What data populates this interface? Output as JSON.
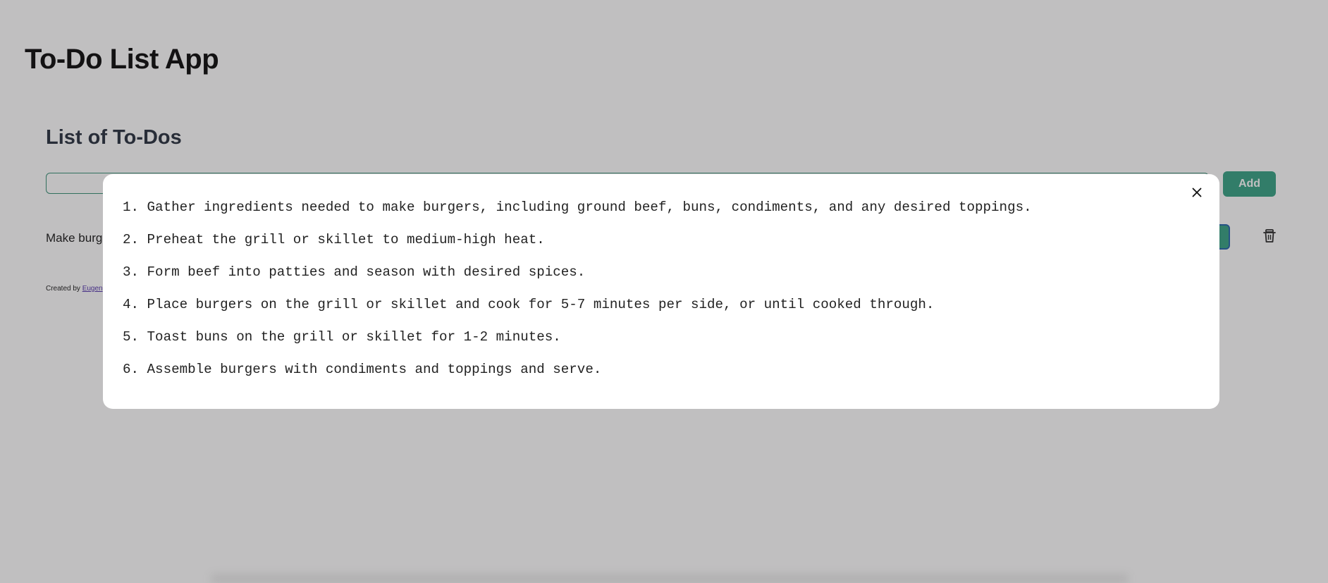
{
  "app": {
    "title": "To-Do List App"
  },
  "card": {
    "title": "List of To-Dos",
    "add_label": "Add",
    "input_value": "",
    "input_placeholder": ""
  },
  "todos": [
    {
      "text": "Make burgers",
      "visible_text": "Make burge"
    }
  ],
  "footer": {
    "prefix": "Created by ",
    "author_link_visible": "Eugen"
  },
  "modal": {
    "steps": [
      "1. Gather ingredients needed to make burgers, including ground beef, buns, condiments, and any desired toppings.",
      "2. Preheat the grill or skillet to medium-high heat.",
      "3. Form beef into patties and season with desired spices.",
      "4. Place burgers on the grill or skillet and cook for 5-7 minutes per side, or until cooked through.",
      "5. Toast buns on the grill or skillet for 1-2 minutes.",
      "6. Assemble burgers with condiments and toppings and serve."
    ]
  },
  "icons": {
    "close": "close-icon",
    "delete": "trash-icon"
  },
  "colors": {
    "accent": "#2f9e7f",
    "accent_border": "#2e8b6f",
    "steps_button_border": "#1d5fa8",
    "overlay": "rgba(60,55,58,0.32)"
  }
}
